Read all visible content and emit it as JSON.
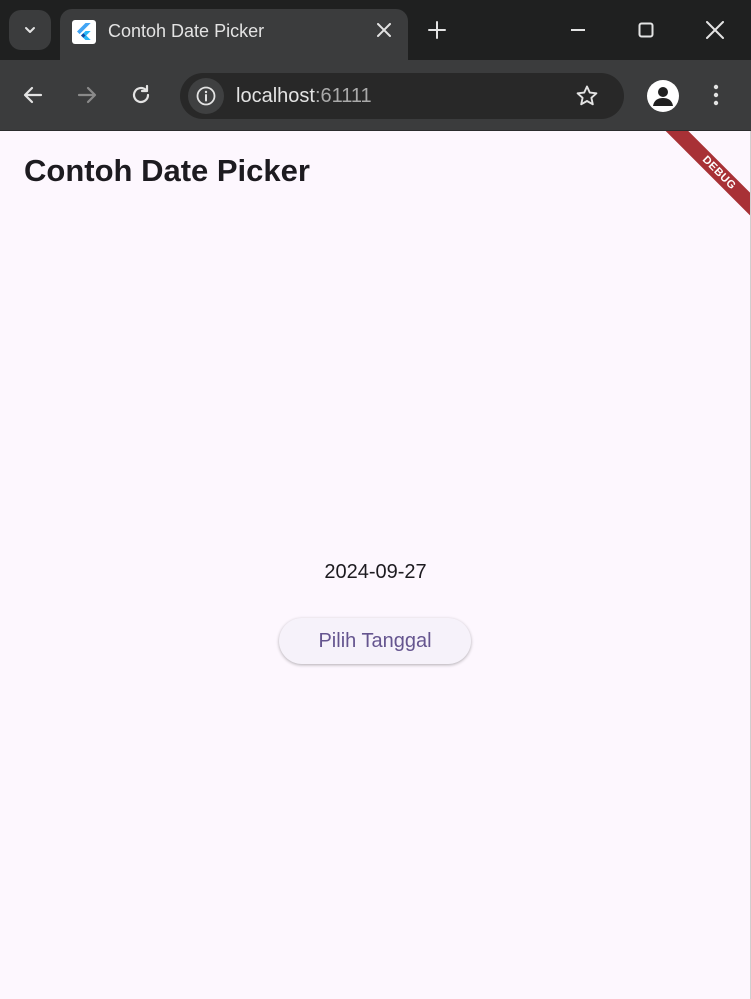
{
  "browser": {
    "tab_title": "Contoh Date Picker",
    "url_host": "localhost",
    "url_port": ":61111",
    "icons": {
      "tab_search": "chevron-down-icon",
      "favicon": "flutter-icon",
      "close_tab": "close-icon",
      "new_tab": "plus-icon",
      "minimize": "minimize-icon",
      "maximize": "maximize-icon",
      "close_window": "close-icon",
      "back": "arrow-left-icon",
      "forward": "arrow-right-icon",
      "reload": "reload-icon",
      "site_info": "info-icon",
      "bookmark": "star-icon",
      "profile": "profile-icon",
      "menu": "more-vert-icon"
    },
    "colors": {
      "frame": "#1f2020",
      "toolbar": "#3b3c3d",
      "omnibox": "#282828"
    }
  },
  "app": {
    "title": "Contoh Date Picker",
    "debug_banner": "DEBUG",
    "selected_date": "2024-09-27",
    "pick_button_label": "Pilih Tanggal",
    "colors": {
      "background": "#fdf7fe",
      "button_text": "#65558f",
      "banner": "#a83136"
    }
  }
}
